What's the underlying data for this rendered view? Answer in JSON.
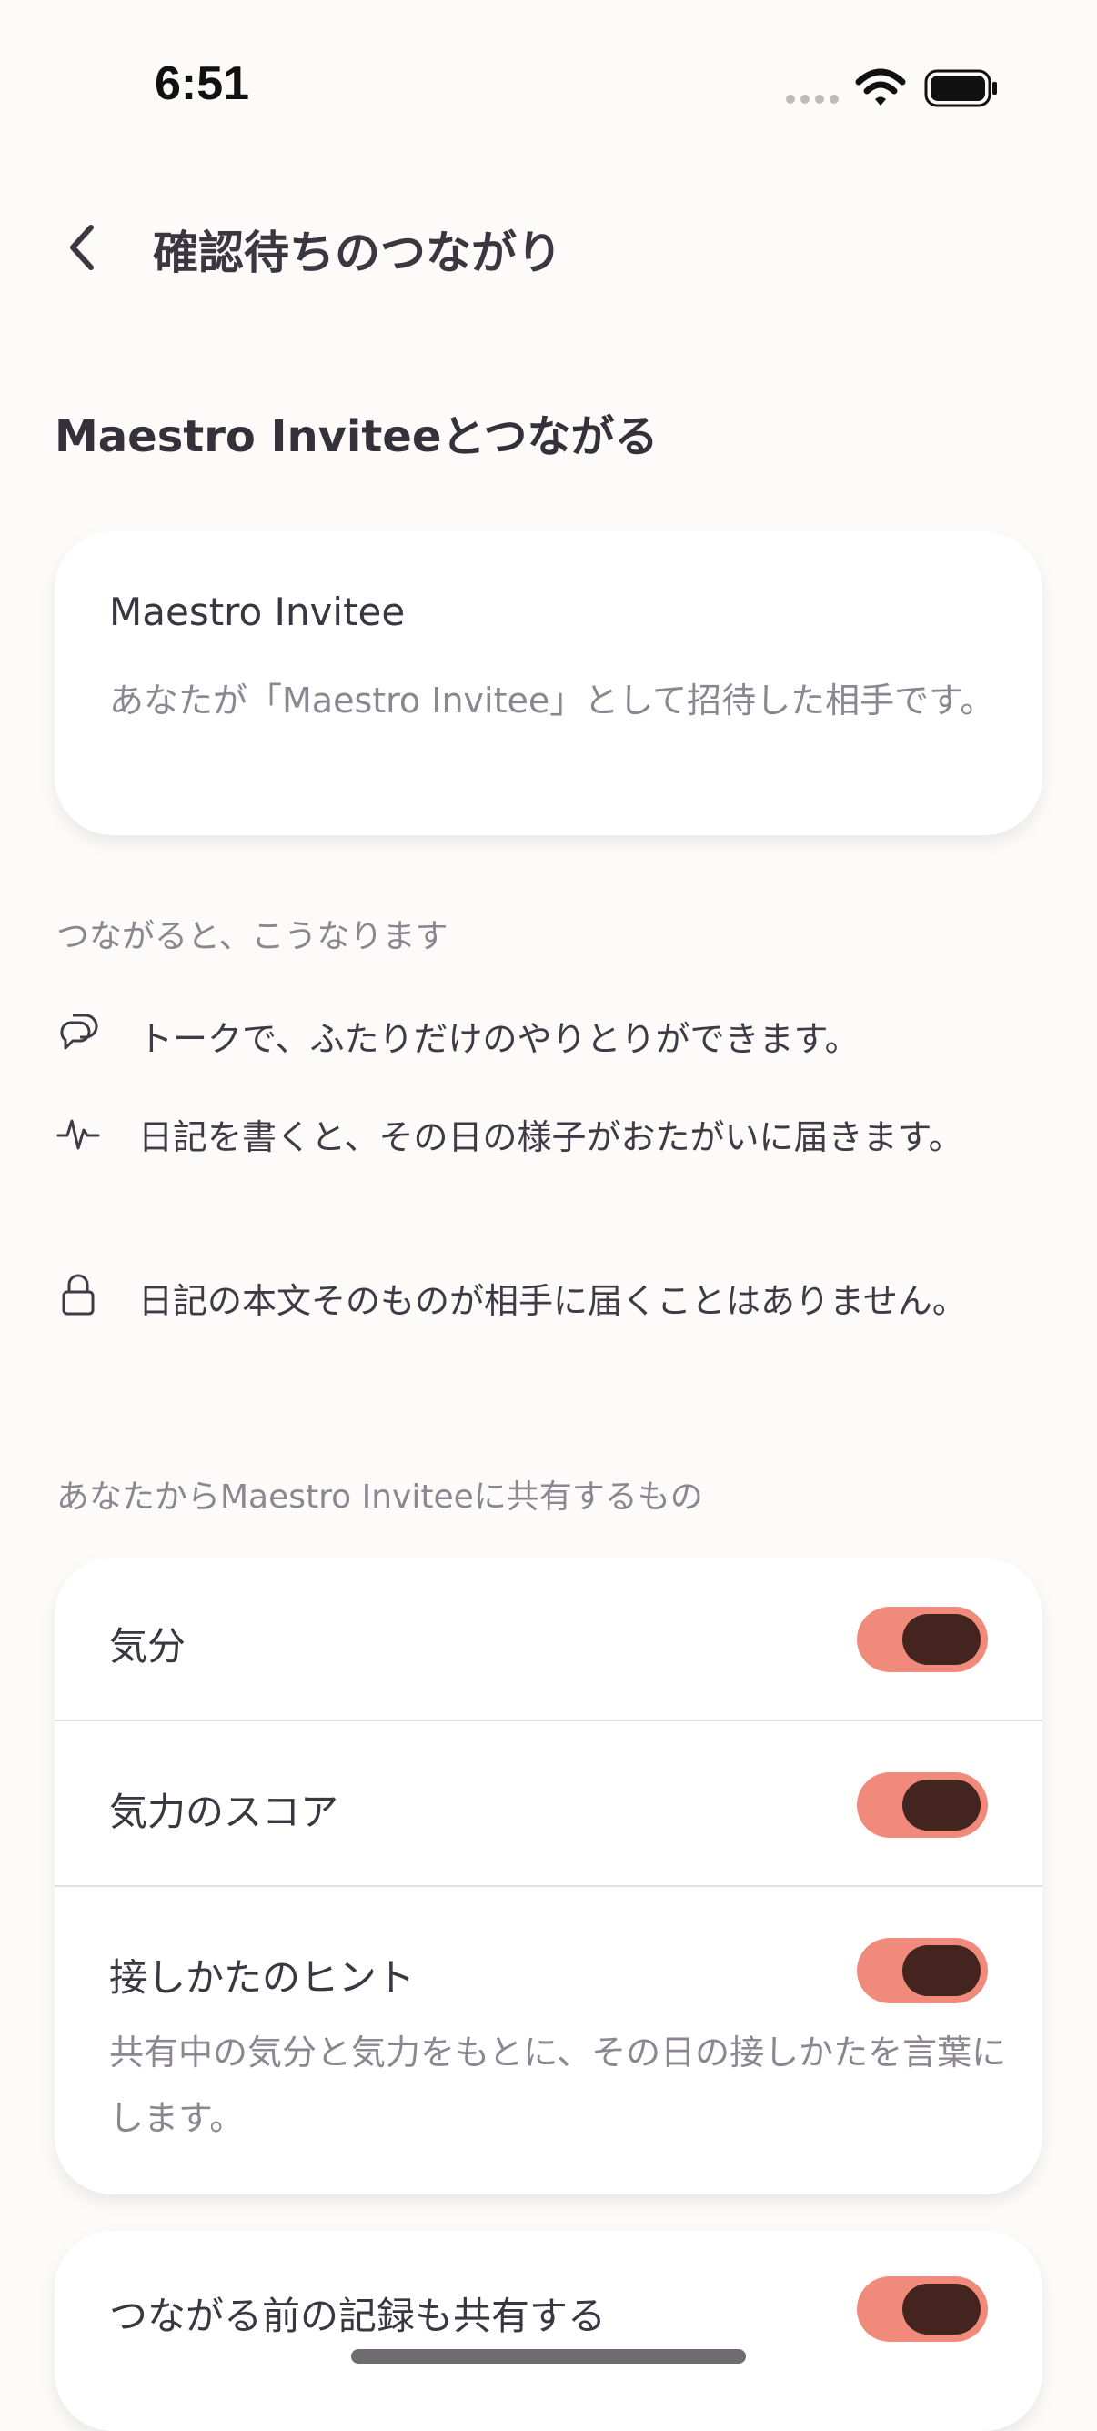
{
  "status_bar": {
    "time": "6:51"
  },
  "header": {
    "title": "確認待ちのつながり"
  },
  "connect_title": "Maestro Inviteeとつながる",
  "invitee_card": {
    "name": "Maestro Invitee",
    "description": "あなたが「Maestro Invitee」として招待した相手です。"
  },
  "benefits": {
    "caption": "つながると、こうなります",
    "items": [
      {
        "icon": "chat-bubbles-icon",
        "text": "トークで、ふたりだけのやりとりができます。"
      },
      {
        "icon": "pulse-icon",
        "text": "日記を書くと、その日の様子がおたがいに届きます。"
      },
      {
        "icon": "lock-icon",
        "text": "日記の本文そのものが相手に届くことはありません。"
      }
    ]
  },
  "sharing": {
    "caption": "あなたからMaestro Inviteeに共有するもの",
    "items": [
      {
        "label": "気分",
        "enabled": true
      },
      {
        "label": "気力のスコア",
        "enabled": true
      },
      {
        "label": "接しかたのヒント",
        "enabled": true,
        "description": "共有中の気分と気力をもとに、その日の接しかたを言葉にします。"
      }
    ],
    "past_records": {
      "label": "つながる前の記録も共有する",
      "enabled": true
    }
  },
  "colors": {
    "toggle_track": "#f08b7b",
    "toggle_knob": "#43241f",
    "background": "#fcfbfa"
  }
}
